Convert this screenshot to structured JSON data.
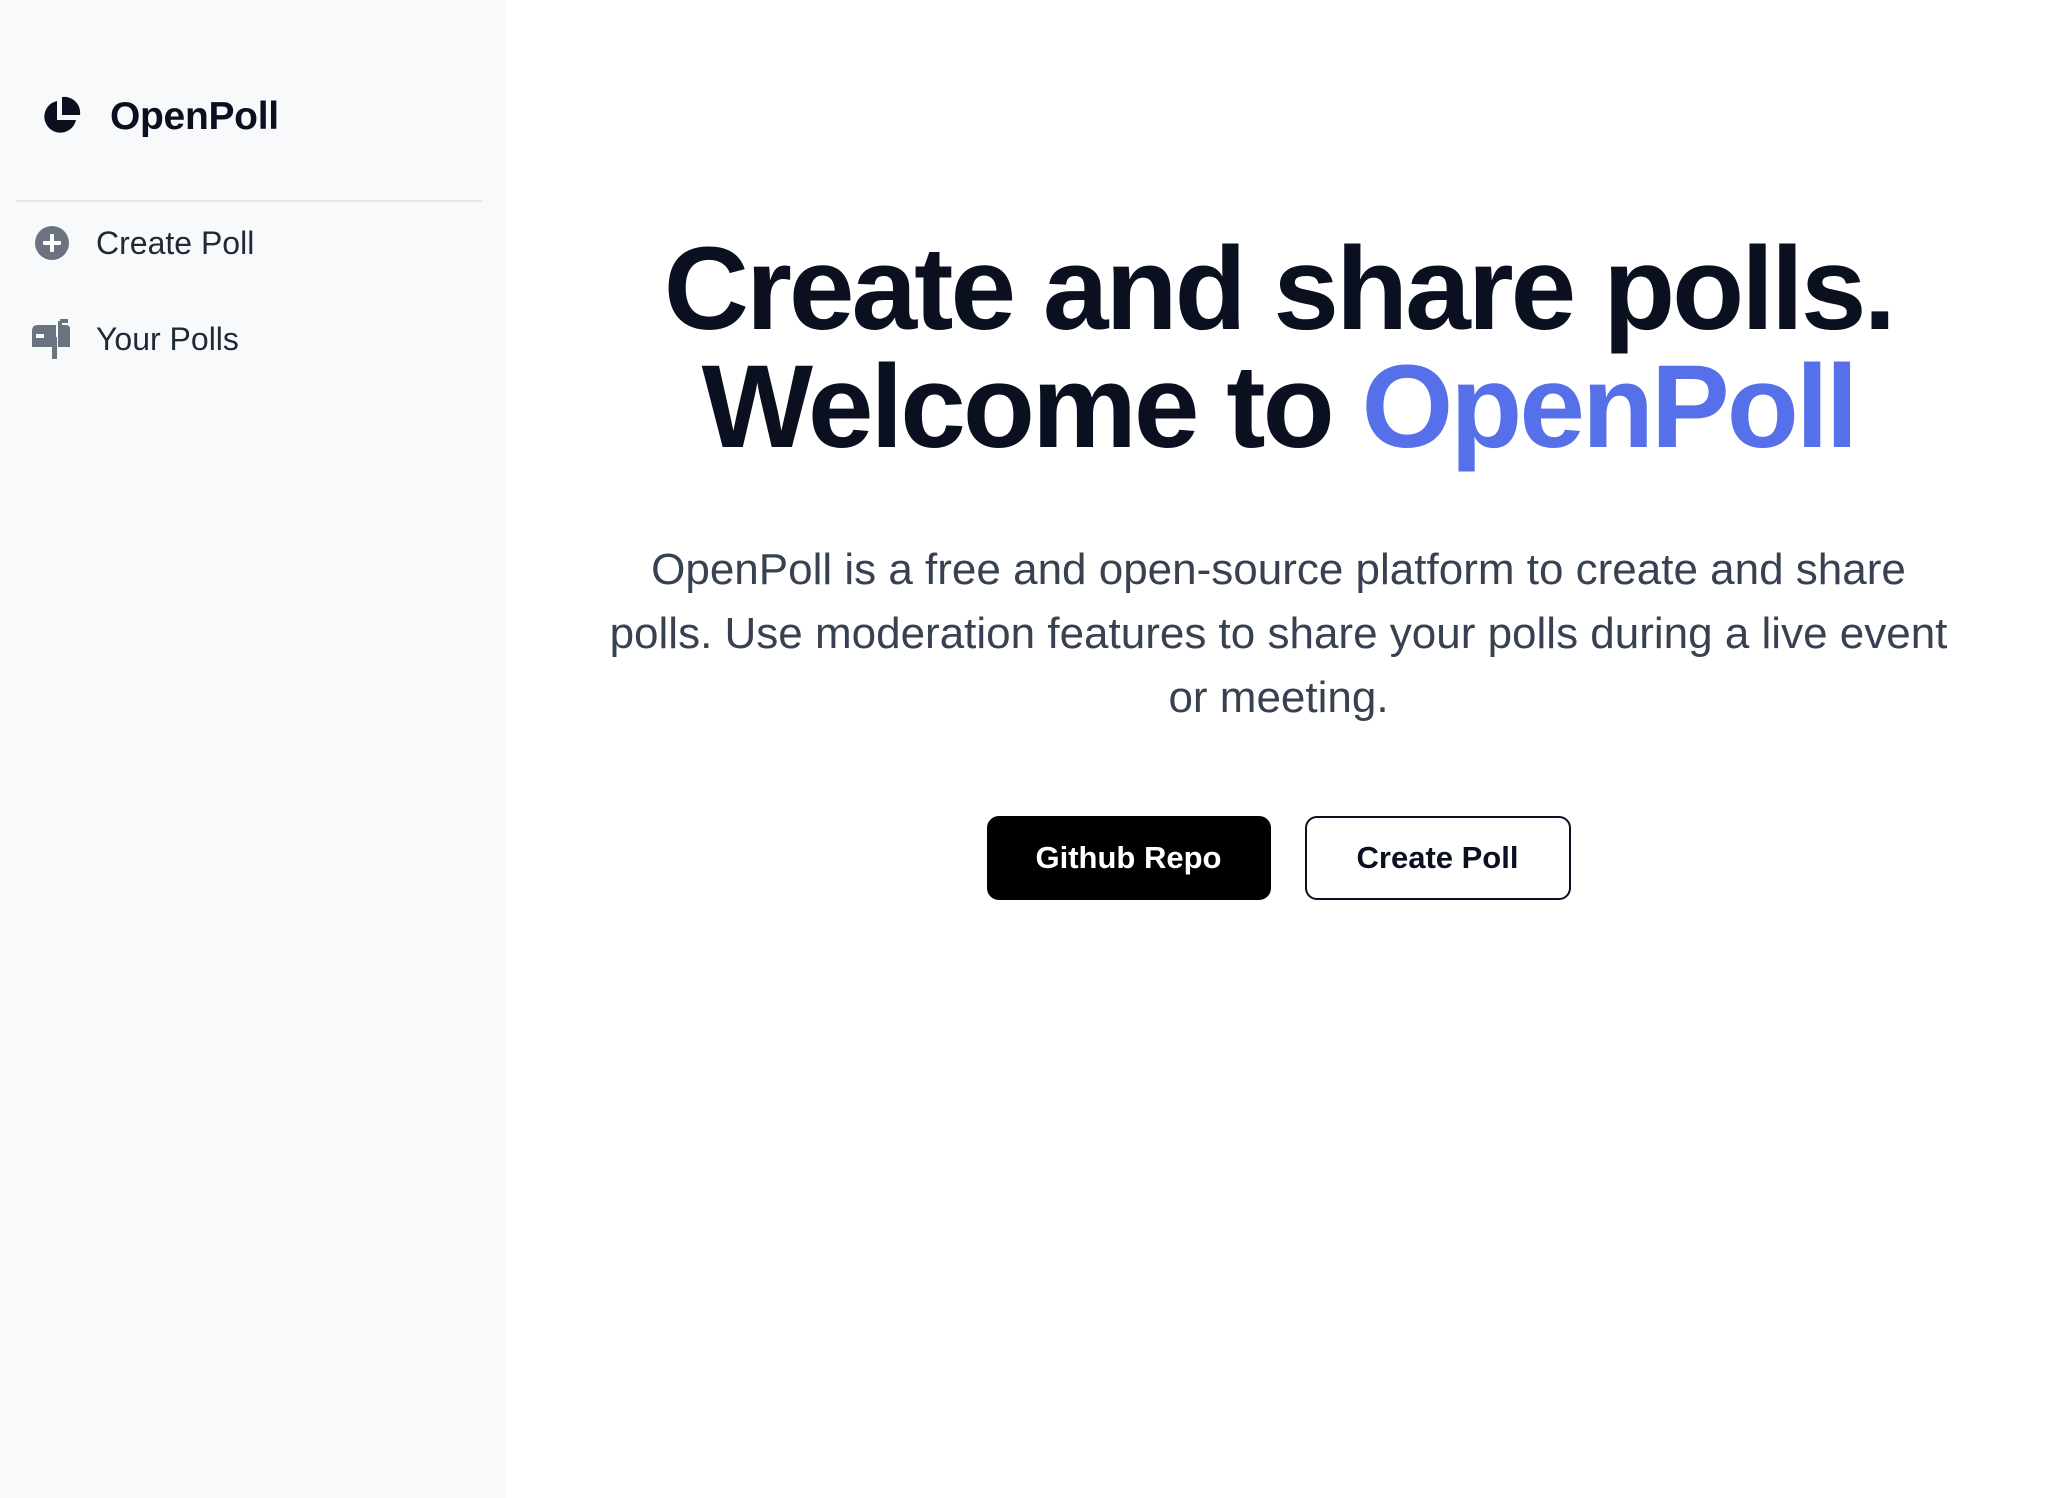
{
  "sidebar": {
    "brand": {
      "name": "OpenPoll",
      "icon": "pie-chart-icon"
    },
    "items": [
      {
        "label": "Create Poll",
        "icon": "plus-circle-icon"
      },
      {
        "label": "Your Polls",
        "icon": "mailbox-icon"
      }
    ]
  },
  "main": {
    "headline": {
      "line1": "Create and share polls.",
      "line2_prefix": "Welcome to ",
      "line2_accent": "OpenPoll"
    },
    "subtitle": "OpenPoll is a free and open-source platform to create and share polls. Use moderation features to share your polls during a live event or meeting.",
    "buttons": {
      "primary_label": "Github Repo",
      "secondary_label": "Create Poll"
    }
  },
  "colors": {
    "accent": "#5670e9",
    "sidebar_bg": "#f8f9fb",
    "text_dark": "#0b1020",
    "icon_gray": "#6b7280"
  }
}
